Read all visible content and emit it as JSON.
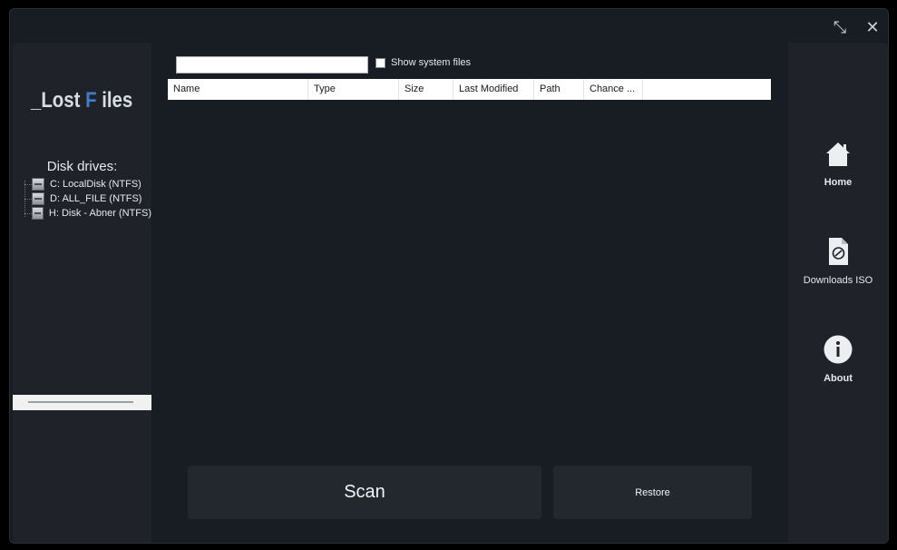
{
  "titlebar": {
    "minimize_glyph": "⤡",
    "close_glyph": "✕"
  },
  "left": {
    "logo_prefix": "_Lost ",
    "logo_accent": "F",
    "logo_suffix": " iles",
    "disk_title": "Disk drives:",
    "drives": [
      {
        "label": "C: LocalDisk (NTFS)",
        "icon": "hard-drive-icon"
      },
      {
        "label": "D: ALL_FILE (NTFS)",
        "icon": "hard-drive-icon"
      },
      {
        "label": "H: Disk - Abner  (NTFS)",
        "icon": "hard-drive-icon"
      }
    ],
    "accent_color": "#3d7fc8"
  },
  "search": {
    "value": "",
    "placeholder": "",
    "show_system_label": "Show system files",
    "show_system_checked": false
  },
  "table": {
    "columns": [
      "Name",
      "Type",
      "Size",
      "Last Modified",
      "Path",
      "Chance ..."
    ],
    "rows": []
  },
  "actions": {
    "scan_label": "Scan",
    "restore_label": "Restore"
  },
  "nav": {
    "home_label": "Home",
    "iso_label": "Downloads ISO",
    "about_label": "About"
  }
}
